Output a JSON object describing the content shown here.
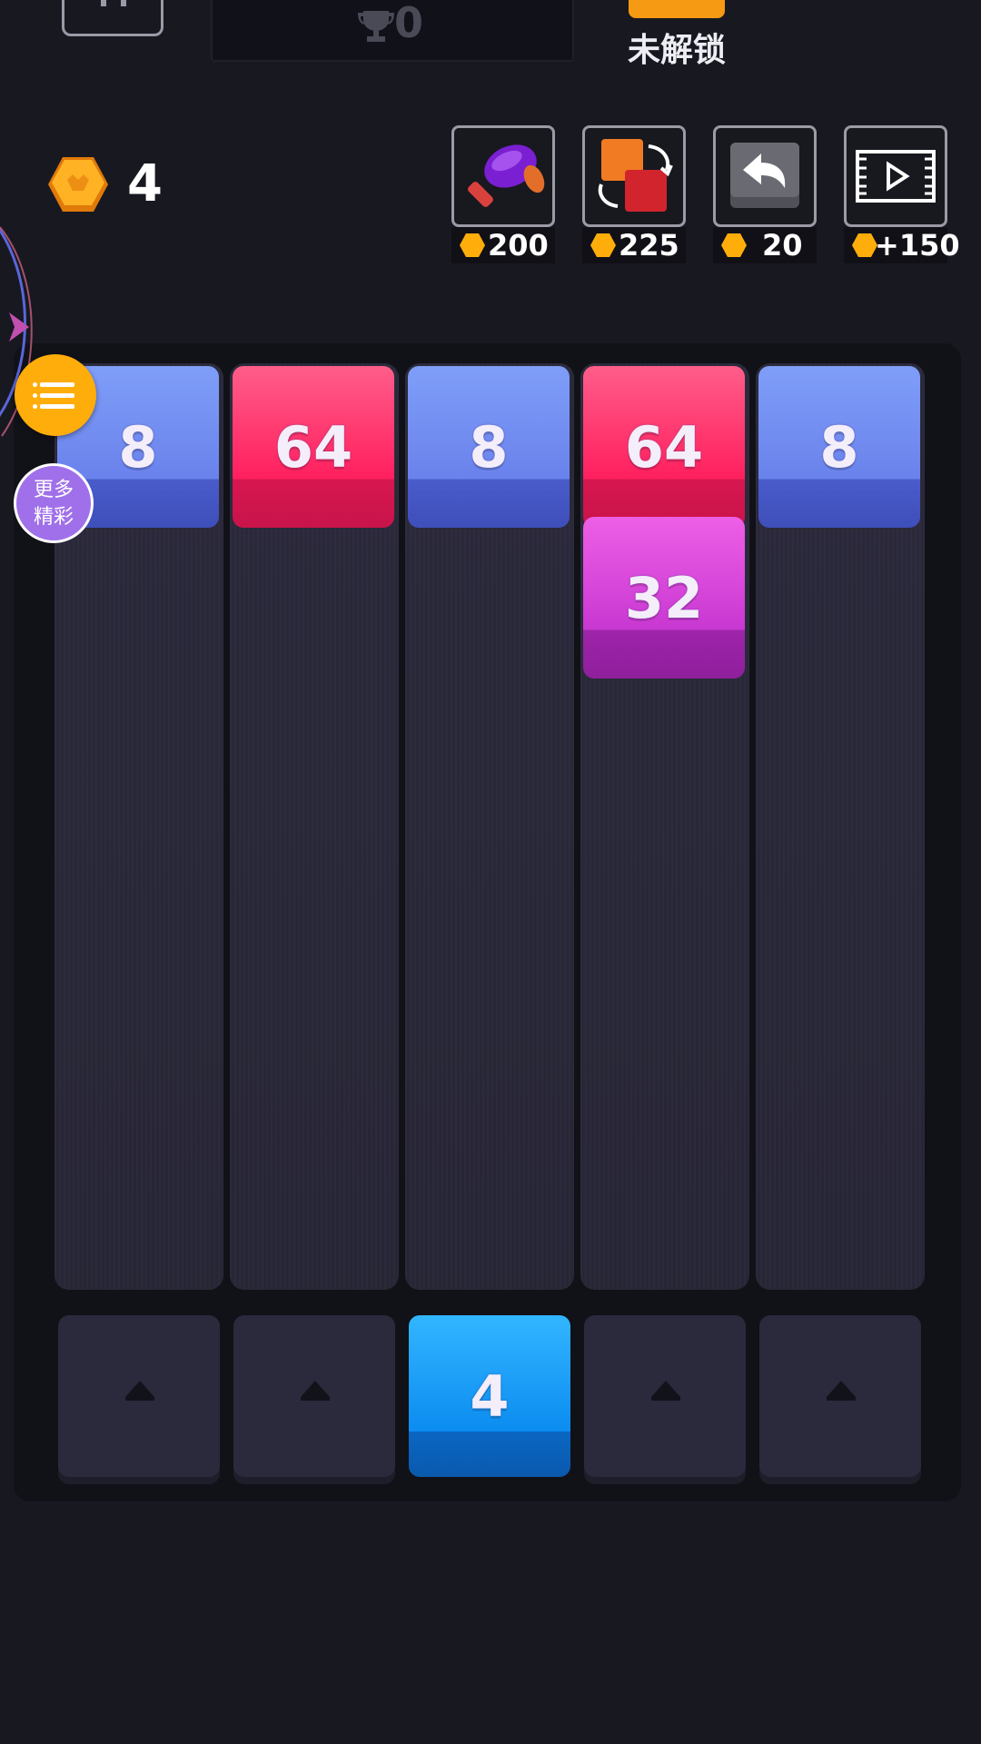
{
  "header": {
    "trophy_score": "0",
    "unlock_label": "未解锁"
  },
  "coins": {
    "count": "4",
    "icon": "hex-coin-icon"
  },
  "powerups": [
    {
      "name": "hammer",
      "icon": "hammer-icon",
      "price": "200"
    },
    {
      "name": "swap",
      "icon": "swap-icon",
      "price": "225"
    },
    {
      "name": "undo",
      "icon": "undo-icon",
      "price": "20"
    },
    {
      "name": "video",
      "icon": "video-icon",
      "price": "+150"
    }
  ],
  "side": {
    "menu_icon": "list-icon",
    "more_label_line1": "更多",
    "more_label_line2": "精彩"
  },
  "board": {
    "columns": [
      {
        "tiles": [
          "8"
        ]
      },
      {
        "tiles": [
          "64"
        ]
      },
      {
        "tiles": [
          "8"
        ]
      },
      {
        "tiles": [
          "64",
          "32"
        ]
      },
      {
        "tiles": [
          "8"
        ]
      }
    ],
    "next_tile": "4",
    "next_tile_column": 3
  },
  "colors": {
    "background": "#181821",
    "coin": "#ffad0a",
    "tile_8": "#6a82ec",
    "tile_64": "#ff1f5e",
    "tile_32": "#c838d2",
    "tile_4": "#0b8cf0",
    "menu_button": "#ffad0a",
    "more_button": "#a070ea"
  }
}
